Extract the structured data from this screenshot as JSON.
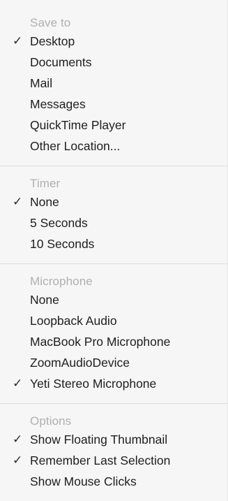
{
  "menu": {
    "sections": [
      {
        "title": "Save to",
        "items": [
          {
            "label": "Desktop",
            "checked": true,
            "check_mark": "✓"
          },
          {
            "label": "Documents",
            "checked": false
          },
          {
            "label": "Mail",
            "checked": false
          },
          {
            "label": "Messages",
            "checked": false
          },
          {
            "label": "QuickTime Player",
            "checked": false
          },
          {
            "label": "Other Location...",
            "checked": false
          }
        ]
      },
      {
        "title": "Timer",
        "items": [
          {
            "label": "None",
            "checked": true,
            "check_mark": "✓"
          },
          {
            "label": "5 Seconds",
            "checked": false
          },
          {
            "label": "10 Seconds",
            "checked": false
          }
        ]
      },
      {
        "title": "Microphone",
        "items": [
          {
            "label": "None",
            "checked": false
          },
          {
            "label": "Loopback Audio",
            "checked": false
          },
          {
            "label": "MacBook Pro Microphone",
            "checked": false
          },
          {
            "label": "ZoomAudioDevice",
            "checked": false
          },
          {
            "label": "Yeti Stereo Microphone",
            "checked": true,
            "check_mark": "✓"
          }
        ]
      },
      {
        "title": "Options",
        "items": [
          {
            "label": "Show Floating Thumbnail",
            "checked": true,
            "check_mark": "✓"
          },
          {
            "label": "Remember Last Selection",
            "checked": true,
            "check_mark": "✓"
          },
          {
            "label": "Show Mouse Clicks",
            "checked": false
          }
        ]
      }
    ]
  },
  "colors": {
    "menu_background": "#f6f6f6",
    "section_title": "#b0b0b0",
    "item_text": "#1e1e1e",
    "divider": "#dcdcdc"
  }
}
